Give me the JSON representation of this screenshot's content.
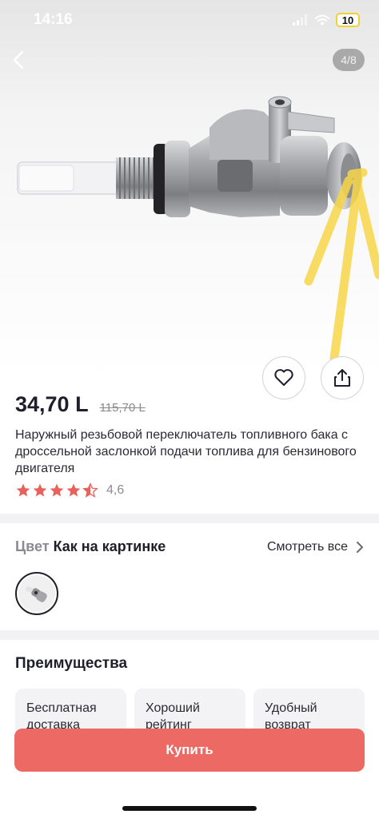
{
  "status_bar": {
    "time": "14:16",
    "battery": "10"
  },
  "gallery": {
    "counter": "4/8"
  },
  "product": {
    "price": "34,70 L",
    "old_price": "115,70 L",
    "title": "Наружный резьбовой переключатель топливного бака с дроссельной заслонкой подачи топлива для бензинового двигателя",
    "rating": "4,6",
    "rating_value": 4.6
  },
  "color": {
    "label": "Цвет",
    "value": "Как на картинке",
    "see_all": "Смотреть все"
  },
  "advantages": {
    "title": "Преимущества",
    "cards": [
      {
        "line1": "Бесплатная",
        "line2": "доставка"
      },
      {
        "line1": "Хороший",
        "line2": "рейтинг"
      },
      {
        "line1": "Удобный",
        "line2": "возврат"
      }
    ]
  },
  "buy_button": {
    "label": "Купить"
  },
  "colors": {
    "accent": "#ec6a63",
    "star": "#e8625c",
    "highlight": "#f7d648"
  }
}
